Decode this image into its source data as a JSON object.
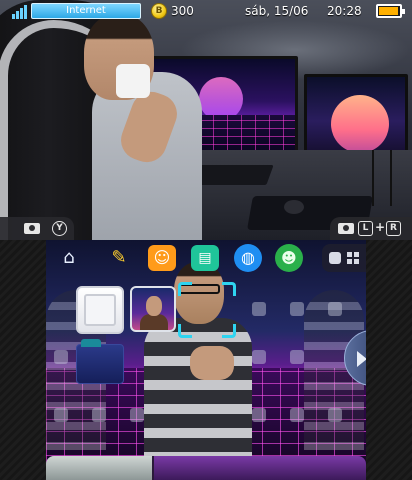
{
  "status_bar": {
    "connection_label": "Internet",
    "play_coins": "300",
    "coin_symbol": "B",
    "date": "sáb, 15/06",
    "time": "20:28",
    "battery_level": 0.95,
    "icons": [
      "signal-icon",
      "coin-icon",
      "battery-icon"
    ]
  },
  "camera_bar": {
    "left_button": "Y",
    "right_buttons": [
      "L",
      "+",
      "R"
    ],
    "icons": [
      "camera-icon",
      "camera-icon"
    ]
  },
  "home_menu": {
    "top_bar_icons": [
      "home-settings-icon",
      "pencil-icon",
      "smiley-icon",
      "chat-icon",
      "globe-icon",
      "friends-icon",
      "single-view-icon",
      "grid-view-icon"
    ],
    "tiles": [
      "empty-slot",
      "app-icon",
      "selected-slot",
      "folder"
    ],
    "scroll_position": 0.33
  },
  "colors": {
    "accent_blue": "#2da8e6",
    "cursor_cyan": "#2fd4f0",
    "synthwave_pink": "#ff50f0",
    "battery_amber": "#ffb000"
  }
}
